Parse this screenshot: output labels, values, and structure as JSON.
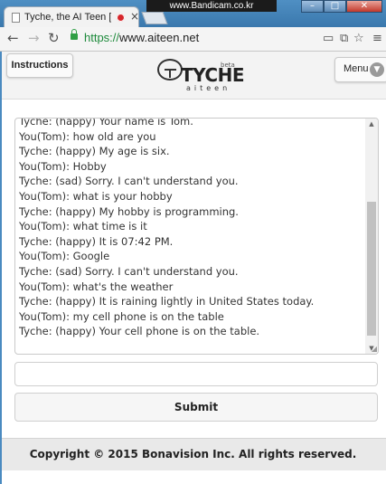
{
  "browser": {
    "tab_title": "Tyche, the AI Teen [Be",
    "tab_close": "×",
    "recorder_watermark": "www.Bandicam.co.kr",
    "url_scheme": "https://",
    "url_host": "www.aiteen.net",
    "icons": [
      "back-arrow-icon",
      "forward-arrow-icon",
      "reload-icon",
      "lock-icon",
      "camera-icon",
      "fullscreen-icon",
      "star-icon",
      "menu-icon"
    ]
  },
  "header": {
    "instructions_label": "Instructions",
    "logo_word": "TYCHE",
    "logo_beta": "beta",
    "logo_sub": "aiteen",
    "menu_label": "Menu"
  },
  "chat": {
    "lines": [
      "Tyche: (happy) Your name is Tom.",
      "You(Tom): how old are you",
      "Tyche: (happy) My age is six.",
      "You(Tom): Hobby",
      "Tyche: (sad) Sorry. I can't understand you.",
      "You(Tom): what is your hobby",
      "Tyche: (happy) My hobby is programming.",
      "You(Tom): what time is it",
      "Tyche: (happy) It is 07:42 PM.",
      "You(Tom): Google",
      "Tyche: (sad) Sorry. I can't understand you.",
      "You(Tom): what's the weather",
      "Tyche: (happy) It is raining lightly in United States today.",
      "You(Tom): my cell phone is on the table",
      "Tyche: (happy) Your cell phone is on the table."
    ]
  },
  "input": {
    "value": "",
    "placeholder": ""
  },
  "submit_label": "Submit",
  "footer_text": "Copyright © 2015 Bonavision Inc. All rights reserved.",
  "colors": {
    "accent_green": "#1d8a3b",
    "record_red": "#d6262b"
  }
}
